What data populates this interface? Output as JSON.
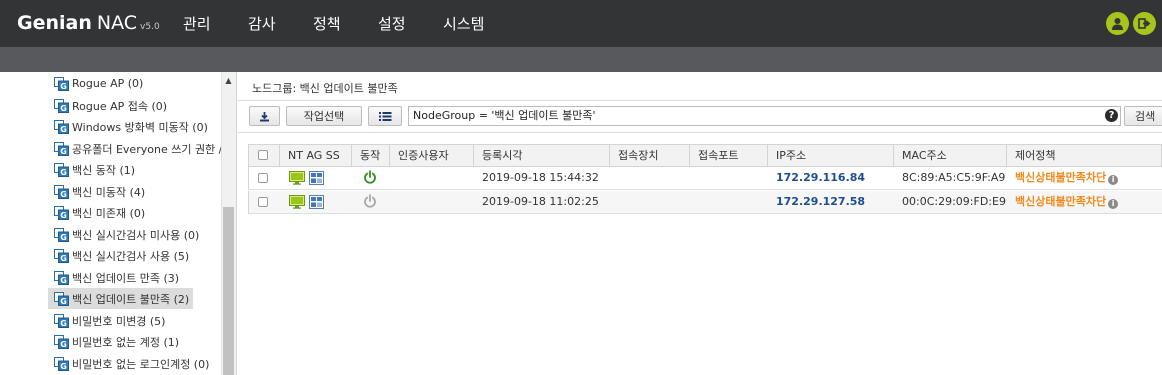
{
  "brand": {
    "name": "Genian",
    "product": "NAC",
    "version": "v5.0"
  },
  "nav": {
    "items": [
      "관리",
      "감사",
      "정책",
      "설정",
      "시스템"
    ]
  },
  "header_icons": [
    "user-icon",
    "logout-icon"
  ],
  "colors": {
    "accent": "#a6c41d",
    "topbar": "#333436",
    "ip_text": "#1f4e8c",
    "policy_text": "#f08a1d"
  },
  "sidebar": {
    "items": [
      {
        "label": "Rogue AP (0)"
      },
      {
        "label": "Rogue AP 접속 (0)"
      },
      {
        "label": "Windows 방화벽 미동작 (0)"
      },
      {
        "label": "공유폴더 Everyone 쓰기 권한 /"
      },
      {
        "label": "백신 동작 (1)"
      },
      {
        "label": "백신 미동작 (4)"
      },
      {
        "label": "백신 미존재 (0)"
      },
      {
        "label": "백신 실시간검사 미사용 (0)"
      },
      {
        "label": "백신 실시간검사 사용 (5)"
      },
      {
        "label": "백신 업데이트 만족 (3)"
      },
      {
        "label": "백신 업데이트 불만족 (2)",
        "selected": true
      },
      {
        "label": "비밀번호 미변경 (5)"
      },
      {
        "label": "비밀번호 없는 계정 (1)"
      },
      {
        "label": "비밀번호 없는 로그인계정 (0)"
      }
    ]
  },
  "main": {
    "title": "노드그룹: 백신 업데이트 불만족",
    "toolbar": {
      "action_select_label": "작업선택",
      "filter_value": "NodeGroup = '백신 업데이트 불만족'",
      "search_label": "검색"
    },
    "table": {
      "columns": [
        "NT AG SS",
        "동작",
        "인증사용자",
        "등록시각",
        "접속장치",
        "접속포트",
        "IP주소",
        "MAC주소",
        "제어정책"
      ],
      "rows": [
        {
          "registered": "2019-09-18 15:44:32",
          "ip": "172.29.116.84",
          "mac": "8C:89:A5:C5:9F:A9",
          "policy": "백신상태불만족차단",
          "power": "on"
        },
        {
          "registered": "2019-09-18 11:02:25",
          "ip": "172.29.127.58",
          "mac": "00:0C:29:09:FD:E9",
          "policy": "백신상태불만족차단",
          "power": "off"
        }
      ]
    }
  }
}
